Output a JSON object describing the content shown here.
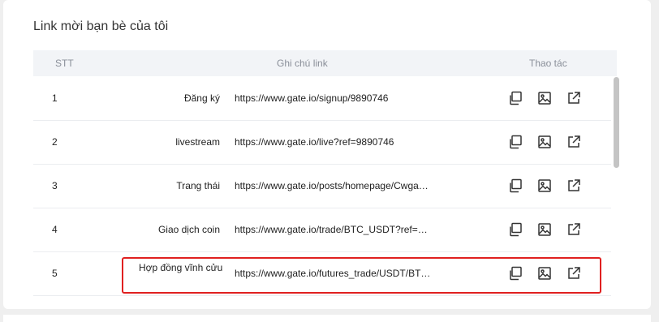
{
  "title": "Link mời bạn bè của tôi",
  "columns": {
    "stt": "STT",
    "note": "Ghi chú link",
    "actions": "Thao tác"
  },
  "rows": [
    {
      "stt": "1",
      "note": "Đăng ký",
      "link": "https://www.gate.io/signup/9890746"
    },
    {
      "stt": "2",
      "note": "livestream",
      "link": "https://www.gate.io/live?ref=9890746"
    },
    {
      "stt": "3",
      "note": "Trang thái",
      "link": "https://www.gate.io/posts/homepage/Cwga…"
    },
    {
      "stt": "4",
      "note": "Giao dịch coin",
      "link": "https://www.gate.io/trade/BTC_USDT?ref=…"
    },
    {
      "stt": "5",
      "note": "Hợp đồng vĩnh cửu",
      "link": "https://www.gate.io/futures_trade/USDT/BT…"
    }
  ],
  "icons": {
    "copy": "copy-icon",
    "image": "image-icon",
    "open": "external-link-icon"
  },
  "highlight_color": "#e02020"
}
